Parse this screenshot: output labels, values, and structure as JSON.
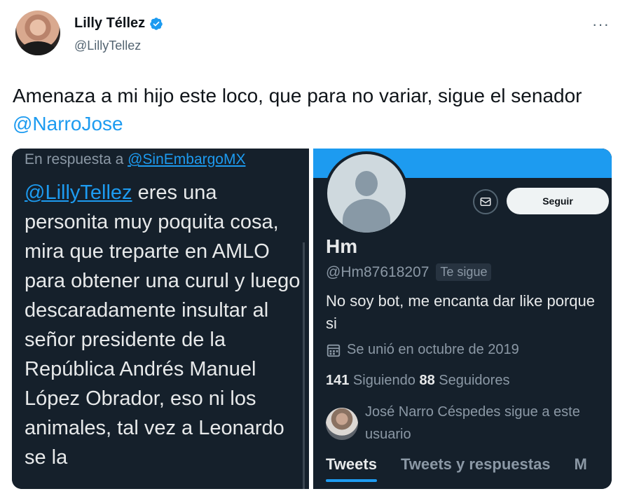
{
  "tweet": {
    "author_name": "Lilly Téllez",
    "author_handle": "@LillyTellez",
    "more_label": "···",
    "text_before": "Amenaza a mi hijo este loco, que para no variar, sigue el senador ",
    "text_mention": "@NarroJose"
  },
  "reply_screenshot": {
    "reply_prefix": "En respuesta a ",
    "reply_to_handle": "@SinEmbargoMX",
    "body_mention": "@LillyTellez",
    "body_text": " eres una personita muy poquita cosa, mira que treparte en AMLO para obtener una curul y luego descaradamente insultar al señor presidente de la República Andrés Manuel López Obrador, eso ni los animales, tal vez  a Leonardo se la"
  },
  "profile_screenshot": {
    "follow_label": "Seguir",
    "display_name": "Hm",
    "handle": "@Hm87618207",
    "follows_you": "Te sigue",
    "bio": "No soy bot, me encanta dar like porque si",
    "joined": "Se unió en octubre de 2019",
    "following_count": "141",
    "following_label": " Siguiendo  ",
    "followers_count": "88",
    "followers_label": " Seguidores",
    "followed_by_text": "José Narro Céspedes sigue a este usuario",
    "tabs": [
      "Tweets",
      "Tweets y respuestas",
      "M"
    ]
  },
  "colors": {
    "accent": "#1d9bf0",
    "dark_bg": "#15202b",
    "muted": "#8b98a5"
  }
}
